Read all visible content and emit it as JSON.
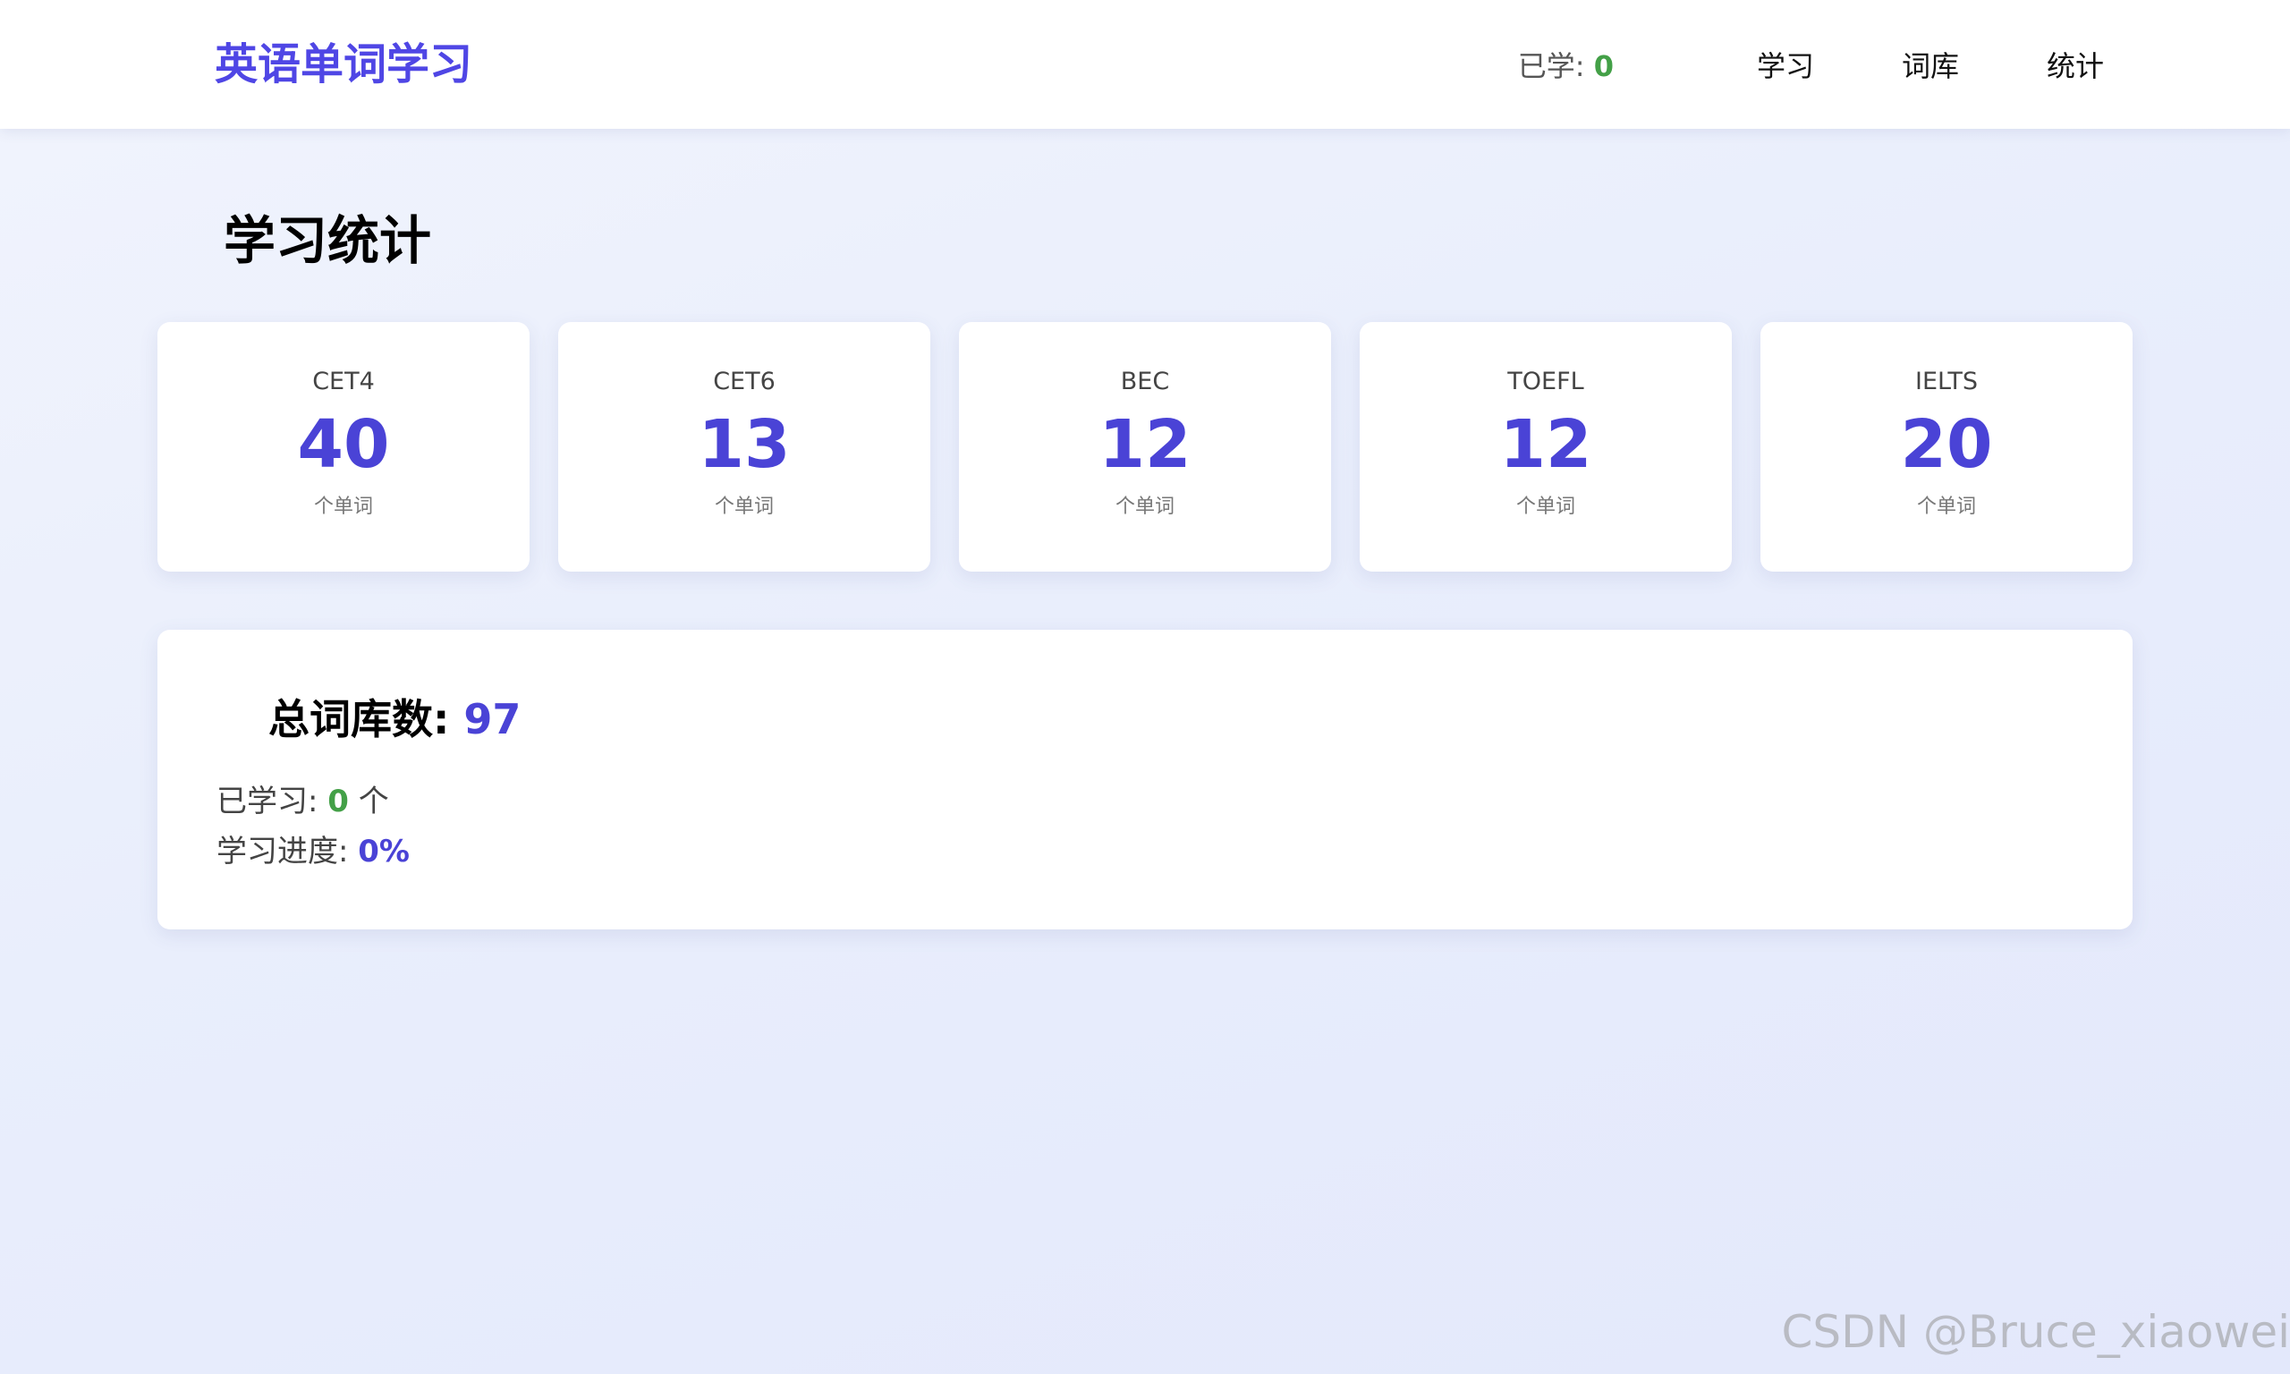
{
  "header": {
    "brand": "英语单词学习",
    "learned_label": "已学: ",
    "learned_count": "0",
    "nav": [
      "学习",
      "词库",
      "统计"
    ]
  },
  "page": {
    "title": "学习统计"
  },
  "categories": [
    {
      "name": "CET4",
      "count": "40",
      "unit": "个单词"
    },
    {
      "name": "CET6",
      "count": "13",
      "unit": "个单词"
    },
    {
      "name": "BEC",
      "count": "12",
      "unit": "个单词"
    },
    {
      "name": "TOEFL",
      "count": "12",
      "unit": "个单词"
    },
    {
      "name": "IELTS",
      "count": "20",
      "unit": "个单词"
    }
  ],
  "summary": {
    "total_label": "总词库数: ",
    "total_value": "97",
    "learned_label": "已学习: ",
    "learned_value": "0",
    "learned_suffix": " 个",
    "progress_label": "学习进度: ",
    "progress_value": "0%"
  },
  "watermark": "CSDN @Bruce_xiaowei",
  "colors": {
    "accent": "#4a43d6",
    "brand": "#4f46e5",
    "success": "#43a047"
  }
}
